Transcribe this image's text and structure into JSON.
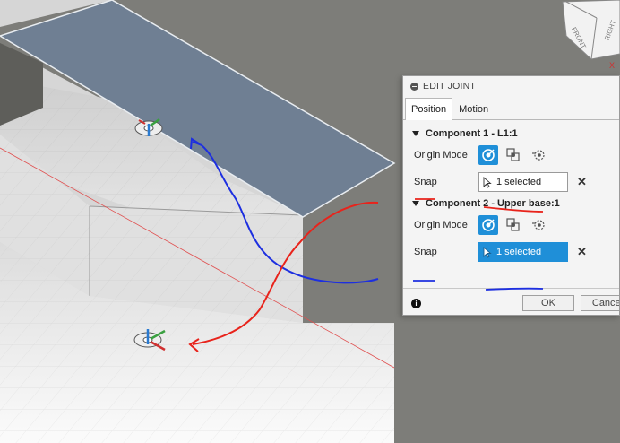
{
  "dialog": {
    "title": "EDIT JOINT",
    "tabs": [
      {
        "label": "Position",
        "active": true
      },
      {
        "label": "Motion",
        "active": false
      }
    ],
    "components": [
      {
        "header": "Component 1 - L1:1",
        "origin_label": "Origin Mode",
        "snap_label": "Snap",
        "snap_value": "1 selected",
        "snap_active": false
      },
      {
        "header": "Component 2 - Upper base:1",
        "origin_label": "Origin Mode",
        "snap_label": "Snap",
        "snap_value": "1 selected",
        "snap_active": true
      }
    ],
    "ok_label": "OK",
    "cancel_label": "Cancel"
  },
  "viewcube": {
    "faces": [
      "FRONT",
      "RIGHT"
    ]
  },
  "colors": {
    "accent": "#1f8fd8",
    "annotation_red": "#e8231b",
    "annotation_blue": "#1d2fe0",
    "plate": "#6f7f93"
  }
}
